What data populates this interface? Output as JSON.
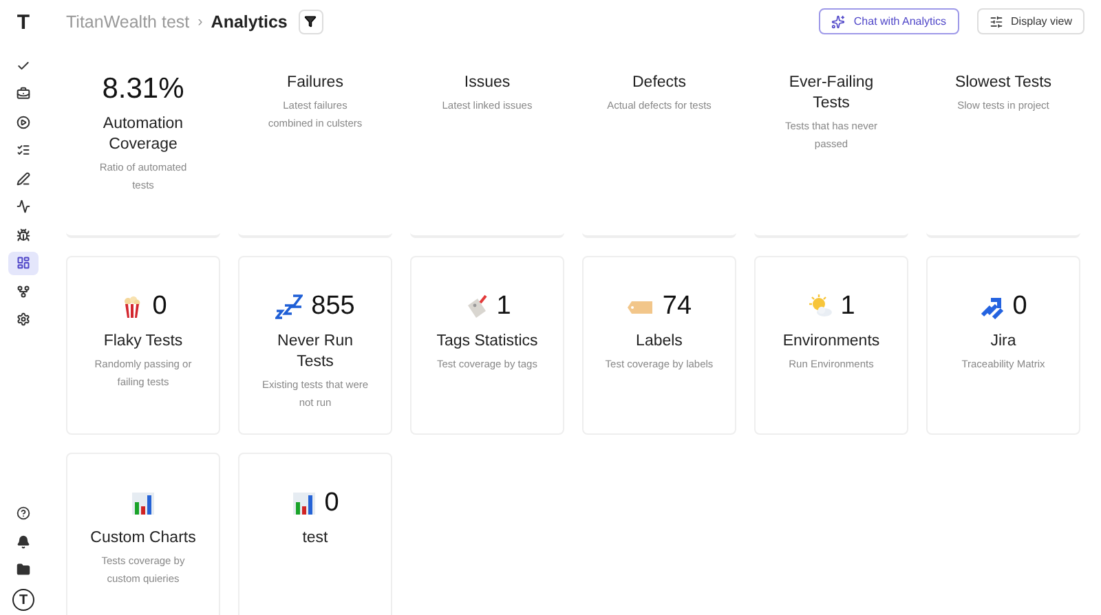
{
  "sidebar": {
    "logo": "T",
    "items": [
      {
        "selected": false
      },
      {
        "selected": false
      },
      {
        "selected": false
      },
      {
        "selected": false
      },
      {
        "selected": false
      },
      {
        "selected": false
      },
      {
        "selected": false
      },
      {
        "selected": true
      },
      {
        "selected": false
      },
      {
        "selected": false
      }
    ],
    "avatar": "T"
  },
  "breadcrumb": {
    "parent": "TitanWealth test",
    "separator": "›",
    "current": "Analytics"
  },
  "buttons": [
    {
      "kind": "accent",
      "label": "Chat with Analytics"
    },
    {
      "kind": "plain",
      "label": "Display view"
    }
  ],
  "cards": [
    {
      "kind": "summary",
      "value": "8.31%",
      "title": "Automation Coverage",
      "subtitle": "Ratio of automated tests"
    },
    {
      "kind": "summary",
      "title": "Failures",
      "subtitle": "Latest failures combined in culsters"
    },
    {
      "kind": "summary",
      "title": "Issues",
      "subtitle": "Latest linked issues"
    },
    {
      "kind": "summary",
      "title": "Defects",
      "subtitle": "Actual defects for tests"
    },
    {
      "kind": "summary",
      "title": "Ever-Failing Tests",
      "subtitle": "Tests that has never passed"
    },
    {
      "kind": "summary",
      "title": "Slowest Tests",
      "subtitle": "Slow tests in project"
    },
    {
      "kind": "metric",
      "value": "0",
      "title": "Flaky Tests",
      "subtitle": "Randomly passing or failing tests"
    },
    {
      "kind": "metric",
      "value": "855",
      "title": "Never Run Tests",
      "subtitle": "Existing tests that were not run"
    },
    {
      "kind": "metric",
      "value": "1",
      "title": "Tags Statistics",
      "subtitle": "Test coverage by tags"
    },
    {
      "kind": "metric",
      "value": "74",
      "title": "Labels",
      "subtitle": "Test coverage by labels"
    },
    {
      "kind": "metric",
      "value": "1",
      "title": "Environments",
      "subtitle": "Run Environments"
    },
    {
      "kind": "metric",
      "value": "0",
      "title": "Jira",
      "subtitle": "Traceability Matrix"
    },
    {
      "kind": "metric",
      "title": "Custom Charts",
      "subtitle": "Tests coverage by custom quieries"
    },
    {
      "kind": "metric",
      "value": "0",
      "title": "test"
    }
  ]
}
